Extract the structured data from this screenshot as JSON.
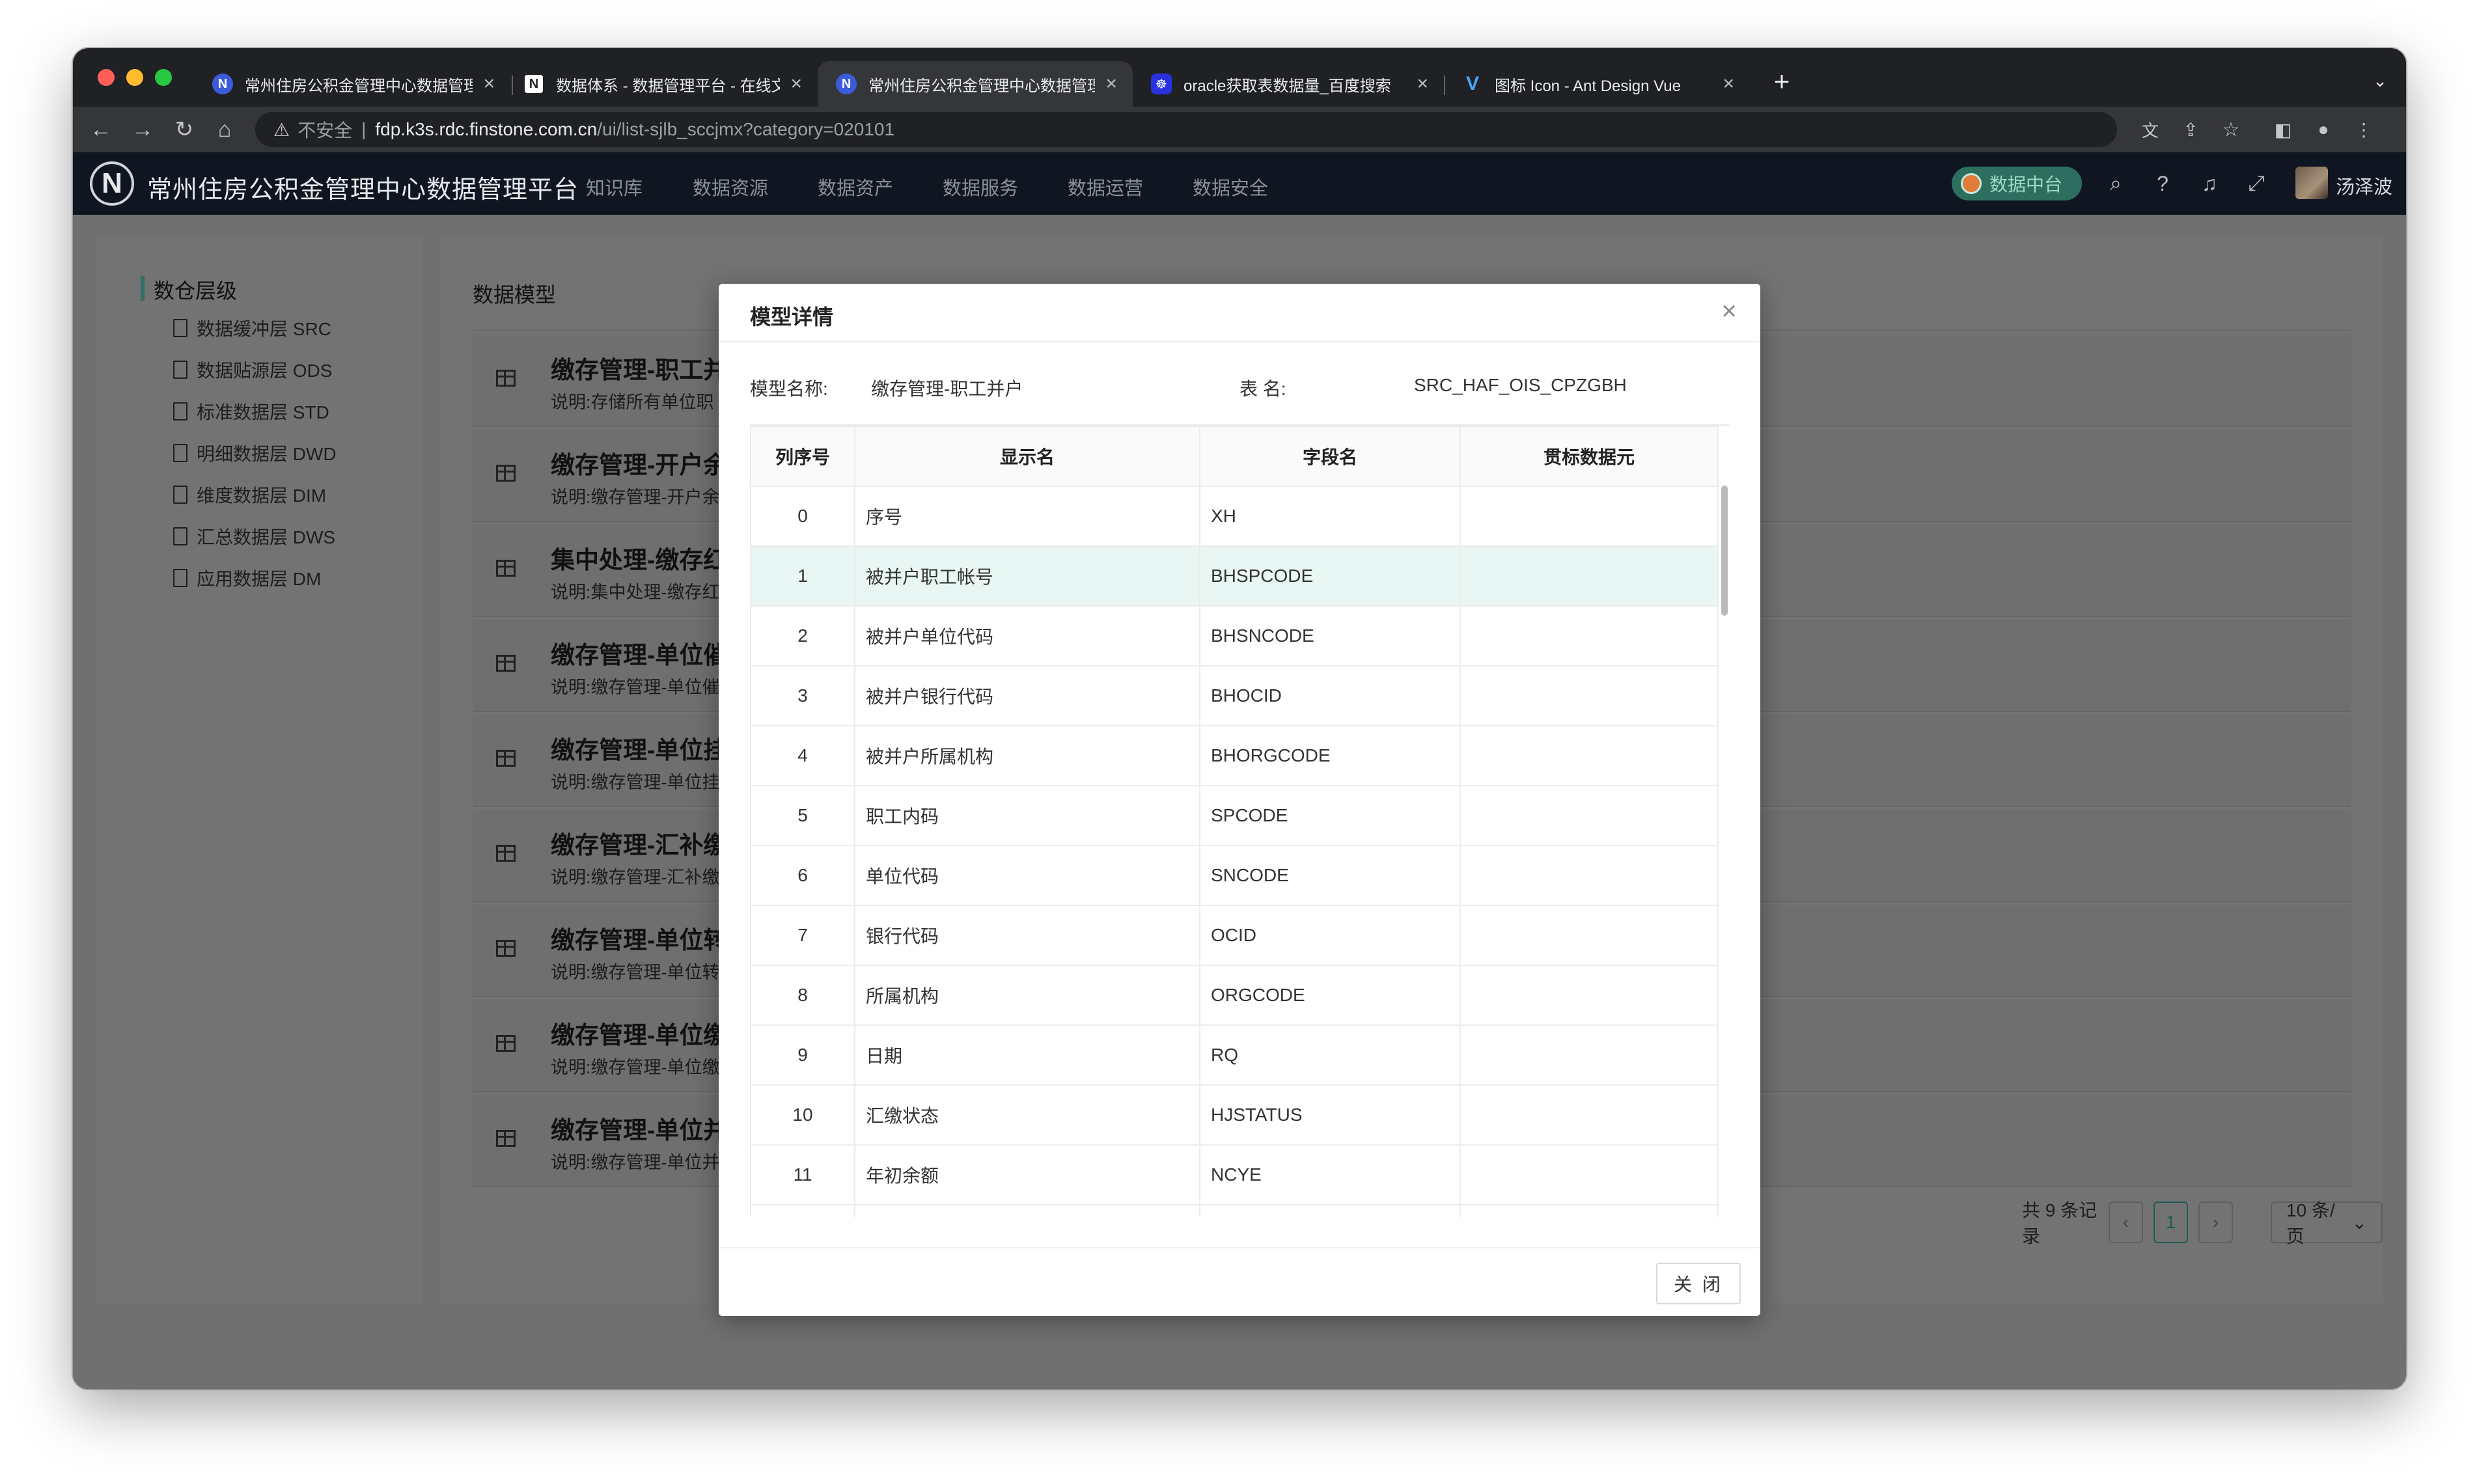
{
  "browser": {
    "tabs": [
      {
        "title": "常州住房公积金管理中心数据管理",
        "favicon": "letter-n-icon",
        "fav_char": "N",
        "active": false
      },
      {
        "title": "数据体系 - 数据管理平台 - 在线文档",
        "favicon": "document-n-icon",
        "fav_char": "N",
        "active": false
      },
      {
        "title": "常州住房公积金管理中心数据管理",
        "favicon": "letter-n-icon",
        "fav_char": "N",
        "active": true
      },
      {
        "title": "oracle获取表数据量_百度搜索",
        "favicon": "baidu-paw-icon",
        "fav_char": "☸",
        "active": false
      },
      {
        "title": "图标 Icon - Ant Design Vue",
        "favicon": "ant-design-vue-icon",
        "fav_char": "V",
        "active": false
      }
    ],
    "new_tab": "+",
    "security_label": "不安全",
    "url_host": "fdp.k3s.rdc.finstone.com.cn",
    "url_path": "/ui/list-sjlb_sccjmx?category=020101"
  },
  "app": {
    "logo_char": "N",
    "title": "常州住房公积金管理中心数据管理平台",
    "nav": [
      "知识库",
      "数据资源",
      "数据资产",
      "数据服务",
      "数据运营",
      "数据安全"
    ],
    "datacenter_label": "数据中台",
    "username": "汤泽波"
  },
  "sidebar": {
    "title": "数仓层级",
    "items": [
      "数据缓冲层 SRC",
      "数据贴源层 ODS",
      "标准数据层 STD",
      "明细数据层 DWD",
      "维度数据层 DIM",
      "汇总数据层 DWS",
      "应用数据层 DM"
    ]
  },
  "main": {
    "title": "数据模型",
    "cards": [
      {
        "title": "缴存管理-职工并",
        "desc": "说明:存储所有单位职"
      },
      {
        "title": "缴存管理-开户余",
        "desc": "说明:缴存管理-开户余"
      },
      {
        "title": "集中处理-缴存红",
        "desc": "说明:集中处理-缴存红"
      },
      {
        "title": "缴存管理-单位催",
        "desc": "说明:缴存管理-单位催"
      },
      {
        "title": "缴存管理-单位挂",
        "desc": "说明:缴存管理-单位挂"
      },
      {
        "title": "缴存管理-汇补缴",
        "desc": "说明:缴存管理-汇补缴"
      },
      {
        "title": "缴存管理-单位转",
        "desc": "说明:缴存管理-单位转"
      },
      {
        "title": "缴存管理-单位缴",
        "desc": "说明:缴存管理-单位缴"
      },
      {
        "title": "缴存管理-单位并",
        "desc": "说明:缴存管理-单位并"
      }
    ],
    "pager": {
      "total": "共 9 条记录",
      "prev": "‹",
      "current": "1",
      "next": "›",
      "page_size": "10 条/页"
    }
  },
  "modal": {
    "title": "模型详情",
    "model_name_label": "模型名称:",
    "model_name": "缴存管理-职工并户",
    "table_name_label": "表 名:",
    "table_name": "SRC_HAF_OIS_CPZGBH",
    "columns": [
      "列序号",
      "显示名",
      "字段名",
      "贯标数据元"
    ],
    "rows": [
      {
        "idx": "0",
        "display": "序号",
        "field": "XH",
        "element": ""
      },
      {
        "idx": "1",
        "display": "被并户职工帐号",
        "field": "BHSPCODE",
        "element": ""
      },
      {
        "idx": "2",
        "display": "被并户单位代码",
        "field": "BHSNCODE",
        "element": ""
      },
      {
        "idx": "3",
        "display": "被并户银行代码",
        "field": "BHOCID",
        "element": ""
      },
      {
        "idx": "4",
        "display": "被并户所属机构",
        "field": "BHORGCODE",
        "element": ""
      },
      {
        "idx": "5",
        "display": "职工内码",
        "field": "SPCODE",
        "element": ""
      },
      {
        "idx": "6",
        "display": "单位代码",
        "field": "SNCODE",
        "element": ""
      },
      {
        "idx": "7",
        "display": "银行代码",
        "field": "OCID",
        "element": ""
      },
      {
        "idx": "8",
        "display": "所属机构",
        "field": "ORGCODE",
        "element": ""
      },
      {
        "idx": "9",
        "display": "日期",
        "field": "RQ",
        "element": ""
      },
      {
        "idx": "10",
        "display": "汇缴状态",
        "field": "HJSTATUS",
        "element": ""
      },
      {
        "idx": "11",
        "display": "年初余额",
        "field": "NCYE",
        "element": ""
      },
      {
        "idx": "",
        "display": "",
        "field": "",
        "element": ""
      }
    ],
    "close_label": "关 闭"
  },
  "colors": {
    "accent": "#2f6f66",
    "highlight_row": "#e8f7f3",
    "header_bg": "#0f1621"
  }
}
